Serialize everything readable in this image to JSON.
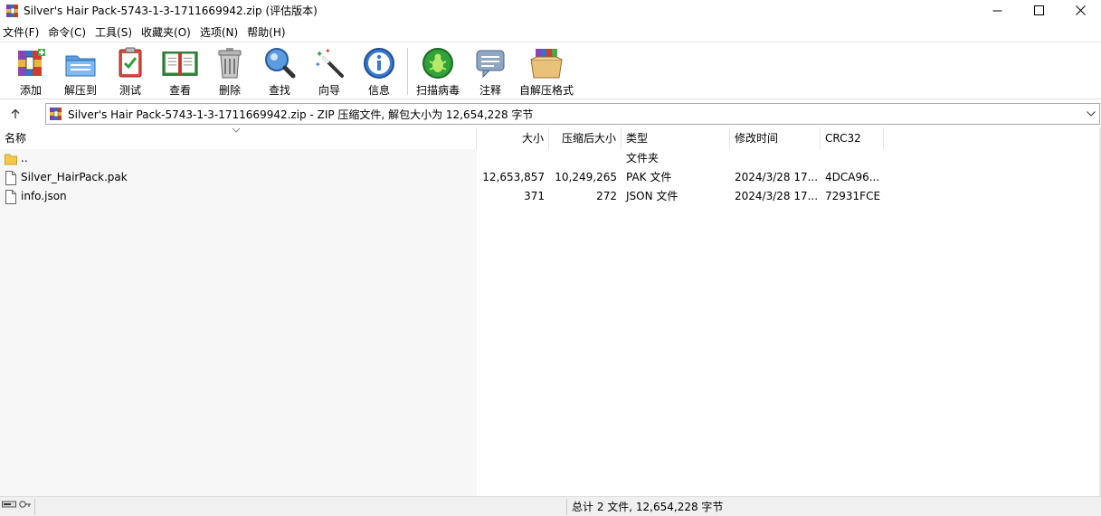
{
  "window": {
    "title": "Silver's Hair Pack-5743-1-3-1711669942.zip (评估版本)",
    "controls": [
      "minimize",
      "maximize",
      "close"
    ]
  },
  "menu": [
    "文件(F)",
    "命令(C)",
    "工具(S)",
    "收藏夹(O)",
    "选项(N)",
    "帮助(H)"
  ],
  "toolbar": [
    {
      "label": "添加",
      "icon": "add-archive-icon"
    },
    {
      "label": "解压到",
      "icon": "extract-to-icon"
    },
    {
      "label": "测试",
      "icon": "test-icon"
    },
    {
      "label": "查看",
      "icon": "view-book-icon"
    },
    {
      "label": "删除",
      "icon": "trash-icon"
    },
    {
      "label": "查找",
      "icon": "find-magnifier-icon"
    },
    {
      "label": "向导",
      "icon": "wizard-wand-icon"
    },
    {
      "label": "信息",
      "icon": "info-icon"
    },
    {
      "label": "扫描病毒",
      "icon": "virus-scan-icon"
    },
    {
      "label": "注释",
      "icon": "comment-icon"
    },
    {
      "label": "自解压格式",
      "icon": "sfx-box-icon"
    }
  ],
  "address": {
    "text": "Silver's Hair Pack-5743-1-3-1711669942.zip - ZIP 压缩文件, 解包大小为 12,654,228 字节"
  },
  "columns": {
    "name": "名称",
    "size": "大小",
    "packed": "压缩后大小",
    "type": "类型",
    "modified": "修改时间",
    "crc": "CRC32"
  },
  "rows": [
    {
      "name": "..",
      "size": "",
      "packed": "",
      "type": "文件夹",
      "modified": "",
      "crc": "",
      "icon": "folder-icon"
    },
    {
      "name": "Silver_HairPack.pak",
      "size": "12,653,857",
      "packed": "10,249,265",
      "type": "PAK 文件",
      "modified": "2024/3/28 17...",
      "crc": "4DCA96...",
      "icon": "file-icon"
    },
    {
      "name": "info.json",
      "size": "371",
      "packed": "272",
      "type": "JSON 文件",
      "modified": "2024/3/28 17...",
      "crc": "72931FCE",
      "icon": "file-icon"
    }
  ],
  "status": {
    "text": "总计 2 文件, 12,654,228 字节"
  }
}
